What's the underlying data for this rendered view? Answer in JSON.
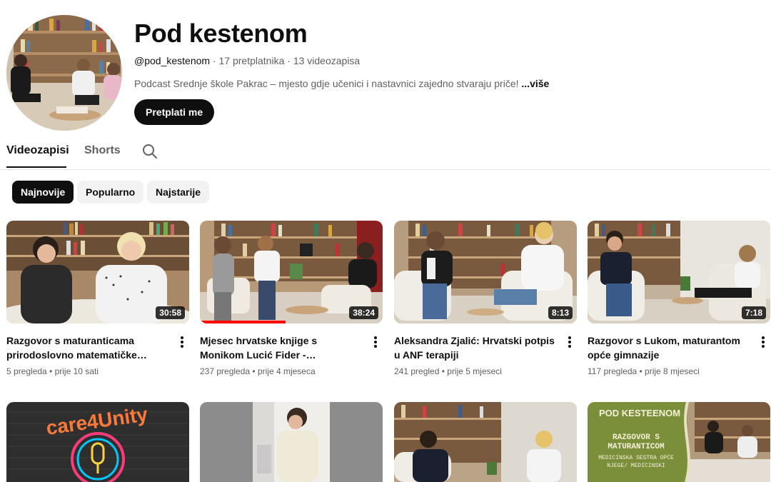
{
  "channel": {
    "name": "Pod kestenom",
    "handle": "@pod_kestenom",
    "subscribers": "17 pretplatnika",
    "videos_count": "13 videozapisa",
    "separator": "·",
    "description": "Podcast Srednje škole Pakrac – mjesto gdje učenici i nastavnici zajedno stvaraju priče!",
    "more_label": "...više",
    "subscribe_label": "Pretplati me"
  },
  "tabs": [
    {
      "label": "Videozapisi",
      "active": true
    },
    {
      "label": "Shorts",
      "active": false
    }
  ],
  "chips": [
    {
      "label": "Najnovije",
      "active": true
    },
    {
      "label": "Popularno",
      "active": false
    },
    {
      "label": "Najstarije",
      "active": false
    }
  ],
  "videos": [
    {
      "title": "Razgovor s maturanticama prirodoslovno matematičke gimnazije",
      "views": "5 pregleda",
      "age": "prije 10 sati",
      "duration": "30:58"
    },
    {
      "title": "Mjesec hrvatske knjige s Monikom Lucić Fider - ravnateljicom gradske knjižnice",
      "views": "237 pregleda",
      "age": "prije 4 mjeseca",
      "duration": "38:24",
      "watched_fraction": 0.47
    },
    {
      "title": "Aleksandra Zjalić: Hrvatski potpis u ANF terapiji",
      "views": "241 pregled",
      "age": "prije 5 mjeseci",
      "duration": "8:13"
    },
    {
      "title": "Razgovor s Lukom, maturantom opće gimnazije",
      "views": "117 pregleda",
      "age": "prije 8 mjeseci",
      "duration": "7:18"
    }
  ],
  "row2_thumbs": [
    {
      "caption": "care4Unity"
    },
    {
      "caption": ""
    },
    {
      "caption": ""
    },
    {
      "caption_top": "POD KESTEENOM",
      "caption_mid": "RAZGOVOR S MATURANTICOM",
      "caption_sub": "MEDICINSKA SESTRA OPĆE NJEGE/ MEDICINSKI"
    }
  ],
  "icons": {
    "search": "search-icon",
    "more": "more-vert-icon"
  },
  "colors": {
    "accent": "#0f0f0f",
    "progress": "#ff0000",
    "secondary_text": "#606060",
    "chip_bg": "#f2f2f2"
  }
}
